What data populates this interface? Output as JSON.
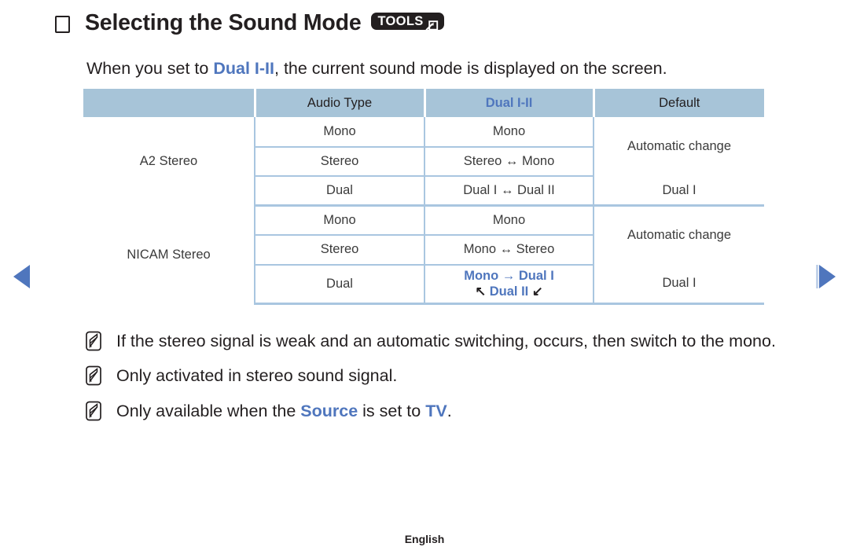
{
  "nav": {
    "prev_label": "Previous page",
    "next_label": "Next page"
  },
  "heading": {
    "title": "Selecting the Sound Mode",
    "badge_label": "TOOLS"
  },
  "intro": {
    "before": "When you set to ",
    "highlight": "Dual I-II",
    "after": ", the current sound mode is displayed on the screen."
  },
  "table": {
    "headers": [
      "",
      "Audio Type",
      "Dual I-II",
      "Default"
    ],
    "groups": [
      {
        "name": "A2 Stereo",
        "rows": [
          {
            "audio_type": "Mono",
            "dual": "Mono",
            "default": "Automatic change"
          },
          {
            "audio_type": "Stereo",
            "dual": "Stereo ↔ Mono",
            "default": ""
          },
          {
            "audio_type": "Dual",
            "dual": "Dual I ↔ Dual II",
            "default": "Dual I"
          }
        ]
      },
      {
        "name": "NICAM Stereo",
        "rows": [
          {
            "audio_type": "Mono",
            "dual": "Mono",
            "default": "Automatic change"
          },
          {
            "audio_type": "Stereo",
            "dual": "Mono ↔ Stereo",
            "default": ""
          },
          {
            "audio_type": "Dual",
            "dual_line1": "Mono → Dual I",
            "dual_line2_arrow_left": "↖",
            "dual_line2_text": "Dual II",
            "dual_line2_arrow_right": "↙",
            "default": "Dual I"
          }
        ]
      }
    ]
  },
  "notes": [
    {
      "text": "If the stereo signal is weak and an automatic switching, occurs, then switch to the mono."
    },
    {
      "text": "Only activated in stereo sound signal."
    },
    {
      "before": "Only available when the ",
      "highlight1": "Source",
      "middle": " is set to ",
      "highlight2": "TV",
      "after": "."
    }
  ],
  "footer": {
    "language": "English"
  },
  "colors": {
    "accent_blue": "#4f76bd",
    "header_fill": "#a7c4d8",
    "rule": "#a9c6e0",
    "text": "#231f20"
  }
}
